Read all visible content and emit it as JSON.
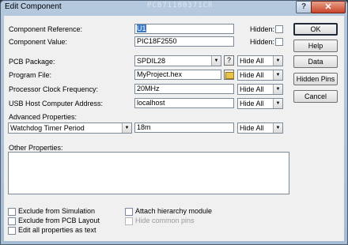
{
  "window": {
    "title": "Edit Component",
    "title_ghost_text": "PCB71180371CR",
    "help_button": "?",
    "close_button": "✕"
  },
  "fields": {
    "component_reference": {
      "label": "Component Reference:",
      "value": "U1",
      "hidden_label": "Hidden:"
    },
    "component_value": {
      "label": "Component Value:",
      "value": "PIC18F2550",
      "hidden_label": "Hidden:"
    },
    "pcb_package": {
      "label": "PCB Package:",
      "value": "SPDIL28",
      "button": "?",
      "visibility": "Hide All"
    },
    "program_file": {
      "label": "Program File:",
      "value": "MyProject.hex",
      "visibility": "Hide All"
    },
    "processor_clock": {
      "label": "Processor Clock Frequency:",
      "value": "20MHz",
      "visibility": "Hide All"
    },
    "usb_host": {
      "label": "USB Host Computer Address:",
      "value": "localhost",
      "visibility": "Hide All"
    }
  },
  "advanced": {
    "label": "Advanced Properties:",
    "property": "Watchdog Timer Period",
    "value": "18m",
    "visibility": "Hide All"
  },
  "other_properties": {
    "label": "Other Properties:",
    "value": ""
  },
  "checkboxes": {
    "exclude_simulation": "Exclude from Simulation",
    "exclude_pcb": "Exclude from PCB Layout",
    "edit_all_text": "Edit all properties as text",
    "attach_hierarchy": "Attach hierarchy module",
    "hide_common_pins": "Hide common pins"
  },
  "buttons": {
    "ok": "OK",
    "help": "Help",
    "data": "Data",
    "hidden_pins": "Hidden Pins",
    "cancel": "Cancel"
  }
}
